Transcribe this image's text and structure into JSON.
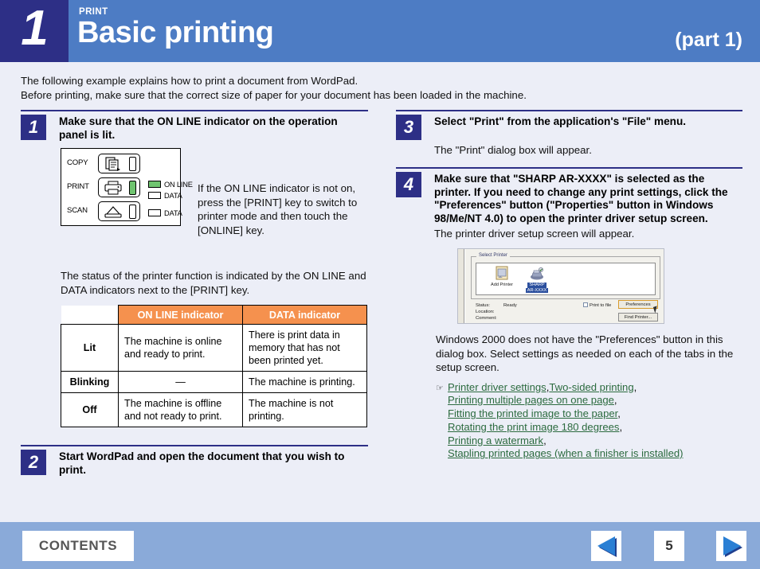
{
  "header": {
    "chapter_number": "1",
    "kicker": "PRINT",
    "title": "Basic printing",
    "part_label": "(part 1)"
  },
  "intro": {
    "line1": "The following example explains how to print a document from WordPad.",
    "line2": "Before printing, make sure that the correct size of paper for your document has been loaded in the machine."
  },
  "steps": {
    "step1": {
      "number": "1",
      "title": "Make sure that the ON LINE indicator on the operation panel is lit.",
      "side_text": "If the ON LINE indicator is not on, press the [PRINT] key to switch to printer mode and then touch the [ONLINE] key.",
      "after_text": "The status of the printer function is indicated by the ON LINE and DATA indicators next to the [PRINT] key."
    },
    "step2": {
      "number": "2",
      "title": "Start WordPad and open the document that you wish to print."
    },
    "step3": {
      "number": "3",
      "title": "Select \"Print\" from the application's \"File\" menu.",
      "sub": "The \"Print\" dialog box will appear."
    },
    "step4": {
      "number": "4",
      "title": "Make sure that \"SHARP AR-XXXX\" is selected as the printer. If you need to change any print settings, click the \"Preferences\" button (\"Properties\" button in Windows 98/Me/NT 4.0) to open the printer driver setup screen.",
      "sub": "The printer driver setup screen will appear.",
      "note": "Windows 2000 does not have the \"Preferences\" button in this dialog box. Select settings as needed on each of the tabs in the setup screen."
    }
  },
  "operation_panel": {
    "rows": [
      {
        "label": "COPY",
        "icon": "copy-key-icon",
        "led_on": false
      },
      {
        "label": "PRINT",
        "icon": "print-key-icon",
        "led_on": true
      },
      {
        "label": "SCAN",
        "icon": "scan-key-icon",
        "led_on": false
      }
    ],
    "indicators": [
      {
        "label": "ON LINE",
        "lit": true
      },
      {
        "label": "DATA",
        "lit": false
      },
      {
        "label": "DATA",
        "lit": false
      }
    ]
  },
  "indicator_table": {
    "headers": [
      "",
      "ON LINE indicator",
      "DATA indicator"
    ],
    "header_bg": "#f5914e",
    "rows": [
      {
        "state": "Lit",
        "online": "The machine is online and ready to print.",
        "data": "There is print data in memory that has not been printed yet."
      },
      {
        "state": "Blinking",
        "online": "—",
        "data": "The machine is printing."
      },
      {
        "state": "Off",
        "online": "The machine is offline and not ready to print.",
        "data": "The machine is not printing."
      }
    ]
  },
  "print_dialog": {
    "group_label": "Select Printer",
    "printers": [
      {
        "name": "Add Printer",
        "selected": false
      },
      {
        "name_line1": "SHARP",
        "name_line2": "AR-XXXX",
        "selected": true
      }
    ],
    "status_label": "Status:",
    "status_value": "Ready",
    "location_label": "Location:",
    "comment_label": "Comment:",
    "print_to_file_label": "Print to file",
    "preferences_button": "Preferences",
    "find_printer_button": "Find Printer..."
  },
  "links": {
    "marker": "☞",
    "items": [
      "Printer driver settings",
      "Two-sided printing",
      "Printing multiple pages on one page",
      "Fitting the printed image to the paper",
      "Rotating the print image 180 degrees",
      "Printing a watermark",
      "Stapling printed pages (when a finisher is installed)"
    ],
    "color": "#2c6b3f"
  },
  "footer": {
    "contents_label": "CONTENTS",
    "page_number": "5",
    "prev_icon": "previous-page-arrow-icon",
    "next_icon": "next-page-arrow-icon",
    "bar_color": "#8aaad9"
  }
}
